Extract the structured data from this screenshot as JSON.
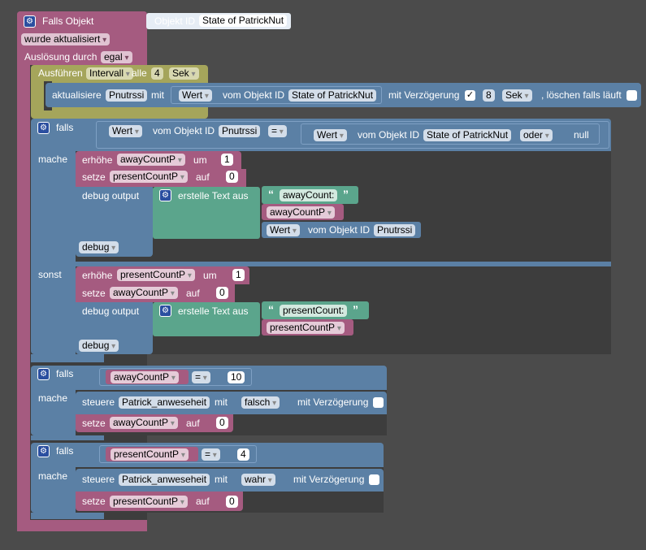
{
  "trigger": {
    "title": "Falls Objekt",
    "object_label": "Objekt ID",
    "object_value": "State of PatrickNut",
    "updated": "wurde aktualisiert",
    "trigger_label": "Auslösung durch",
    "trigger_value": "egal"
  },
  "timer": {
    "run_label": "Ausführen",
    "interval_value": "Intervall",
    "every_label": "alle",
    "every_value": "4",
    "unit_value": "Sek"
  },
  "update_block": {
    "label": "aktualisiere",
    "var": "Pnutrssi",
    "with": "mit",
    "value_field": "Wert",
    "of_object": "vom Objekt ID",
    "object": "State of PatrickNut",
    "delay_label": "mit Verzögerung",
    "delay_checked": "✓",
    "delay_value": "8",
    "delay_unit": "Sek",
    "clear_label": ", löschen falls läuft"
  },
  "if1": {
    "if_label": "falls",
    "left_field": "Wert",
    "left_of": "vom Objekt ID",
    "left_obj": "Pnutrssi",
    "op": "=",
    "right_field": "Wert",
    "right_of": "vom Objekt ID",
    "right_obj": "State of PatrickNut",
    "or_label": "oder",
    "null_label": "null",
    "do_label": "mache",
    "else_label": "sonst",
    "then": {
      "inc_label": "erhöhe",
      "inc_var": "awayCountP",
      "by_label": "um",
      "by_value": "1",
      "set_label": "setze",
      "set_var": "presentCountP",
      "to_label": "auf",
      "to_value": "0",
      "debug_label": "debug output",
      "text_label": "erstelle Text aus",
      "text_str": "awayCount:",
      "text_var": "awayCountP",
      "text_field": "Wert",
      "text_of": "vom Objekt ID",
      "text_obj": "Pnutrssi",
      "level": "debug"
    },
    "else": {
      "inc_label": "erhöhe",
      "inc_var": "presentCountP",
      "by_label": "um",
      "by_value": "1",
      "set_label": "setze",
      "set_var": "awayCountP",
      "to_label": "auf",
      "to_value": "0",
      "debug_label": "debug output",
      "text_label": "erstelle Text aus",
      "text_str": "presentCount:",
      "text_var": "presentCountP",
      "level": "debug"
    }
  },
  "if2": {
    "if_label": "falls",
    "var": "awayCountP",
    "op": "=",
    "value": "10",
    "do_label": "mache",
    "ctrl_label": "steuere",
    "ctrl_obj": "Patrick_anweseheit",
    "with": "mit",
    "ctrl_value": "falsch",
    "delay_label": "mit Verzögerung",
    "set_label": "setze",
    "set_var": "awayCountP",
    "to_label": "auf",
    "to_value": "0"
  },
  "if3": {
    "if_label": "falls",
    "var": "presentCountP",
    "op": "=",
    "value": "4",
    "do_label": "mache",
    "ctrl_label": "steuere",
    "ctrl_obj": "Patrick_anweseheit",
    "with": "mit",
    "ctrl_value": "wahr",
    "delay_label": "mit Verzögerung",
    "set_label": "setze",
    "set_var": "presentCountP",
    "to_label": "auf",
    "to_value": "0"
  }
}
